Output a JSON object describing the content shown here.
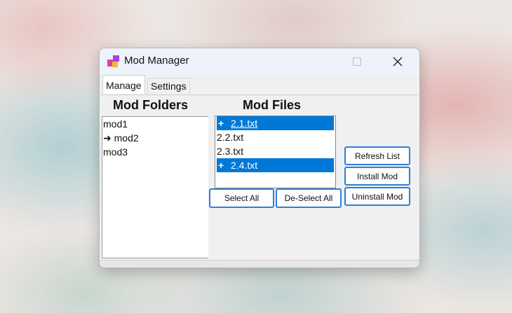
{
  "window": {
    "title": "Mod Manager",
    "controls": {
      "maximize": "maximize",
      "close": "close"
    }
  },
  "tabs": [
    {
      "label": "Manage",
      "active": true
    },
    {
      "label": "Settings",
      "active": false
    }
  ],
  "folders": {
    "heading": "Mod Folders",
    "items": [
      {
        "label": "mod1",
        "prefix": ""
      },
      {
        "label": "mod2",
        "prefix": "➜ "
      },
      {
        "label": "mod3",
        "prefix": ""
      }
    ]
  },
  "files": {
    "heading": "Mod Files",
    "items": [
      {
        "label": "2.1.txt",
        "selected": true,
        "marker": "+"
      },
      {
        "label": "2.2.txt",
        "selected": false,
        "marker": ""
      },
      {
        "label": "2.3.txt",
        "selected": false,
        "marker": ""
      },
      {
        "label": "2.4.txt",
        "selected": true,
        "marker": "+"
      }
    ]
  },
  "buttons": {
    "select_all": "Select All",
    "deselect_all": "De-Select All",
    "refresh": "Refresh List",
    "install": "Install Mod",
    "uninstall": "Uninstall Mod"
  },
  "colors": {
    "selection": "#0078d7",
    "button_border": "#2f7fd8"
  }
}
